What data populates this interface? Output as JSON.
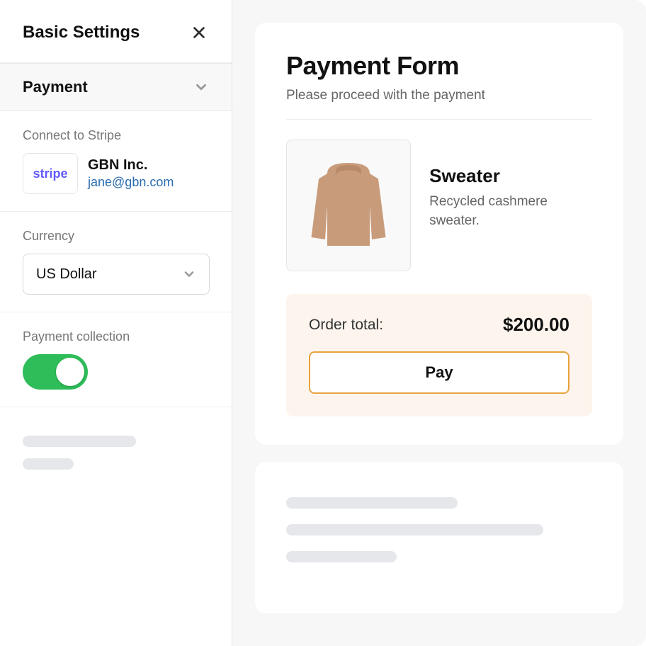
{
  "sidebar": {
    "title": "Basic Settings",
    "sections": {
      "payment": {
        "header": "Payment",
        "connect_label": "Connect to Stripe",
        "stripe_brand": "stripe",
        "company": "GBN Inc.",
        "email": "jane@gbn.com",
        "currency_label": "Currency",
        "currency_value": "US Dollar",
        "collection_label": "Payment collection",
        "collection_enabled": true
      }
    }
  },
  "form": {
    "title": "Payment Form",
    "subtitle": "Please proceed with the payment",
    "product": {
      "name": "Sweater",
      "description": "Recycled cashmere sweater."
    },
    "order": {
      "label": "Order total:",
      "total": "$200.00",
      "pay_label": "Pay"
    }
  },
  "colors": {
    "accent_green": "#2ebd59",
    "accent_orange": "#e8a33d",
    "order_bg": "#fdf5ed",
    "stripe_brand": "#635bff",
    "link": "#2b6cb0"
  }
}
